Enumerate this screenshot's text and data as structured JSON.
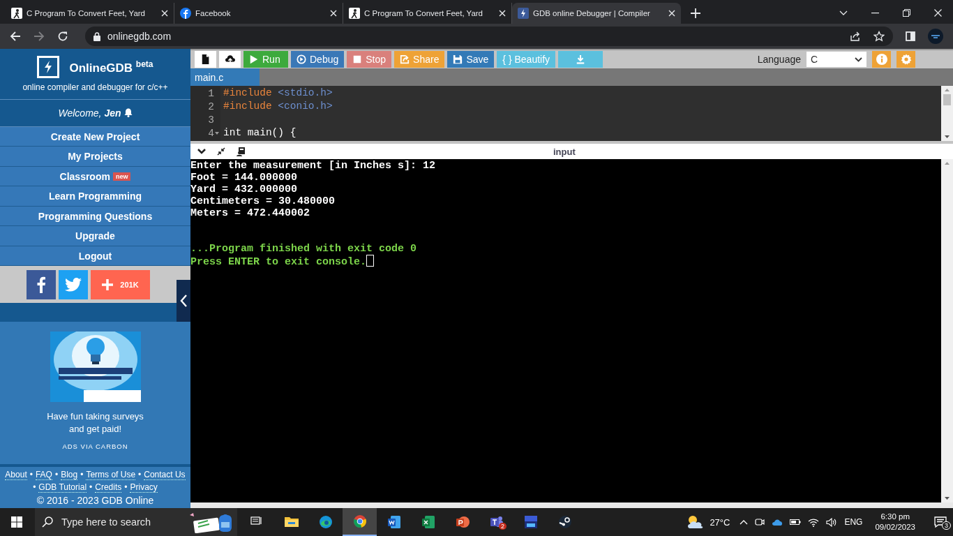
{
  "browser": {
    "tabs": [
      {
        "title": "C Program To Convert Feet, Yard",
        "kind": "figure",
        "selected": false
      },
      {
        "title": "Facebook",
        "kind": "facebook",
        "selected": false
      },
      {
        "title": "C Program To Convert Feet, Yard",
        "kind": "figure",
        "selected": false
      },
      {
        "title": "GDB online Debugger | Compiler",
        "kind": "bolt",
        "selected": true
      }
    ],
    "address": "onlinegdb.com"
  },
  "sidebar": {
    "brand": "OnlineGDB $^{beta}$",
    "tagline": "online compiler and debugger for c/c++",
    "welcome": "Welcome, **Jen**",
    "menu": [
      {
        "label": "Create New Project"
      },
      {
        "label": "My Projects"
      },
      {
        "label": "Classroom",
        "badge": "new"
      },
      {
        "label": "Learn Programming"
      },
      {
        "label": "Programming Questions"
      },
      {
        "label": "Upgrade"
      },
      {
        "label": "Logout"
      }
    ],
    "share_count": "201K",
    "ad": {
      "kind": "picture",
      "text": "Have fun taking surveys and get paid!",
      "via": "ADS VIA CARBON"
    },
    "separator": "•",
    "footer_rows": [
      {
        "lead_separator": false,
        "links": [
          "About",
          "FAQ",
          "Blog",
          "Terms of Use",
          "Contact Us"
        ]
      },
      {
        "lead_separator": true,
        "links": [
          "GDB Tutorial",
          "Credits",
          "Privacy"
        ]
      }
    ],
    "copyright": "© 2016 - 2023 GDB Online"
  },
  "toolbar": {
    "buttons": [
      {
        "kind": "new_file"
      },
      {
        "kind": "upload"
      },
      {
        "kind": "run",
        "label": "Run"
      },
      {
        "kind": "debug",
        "label": "Debug"
      },
      {
        "kind": "stop",
        "label": "Stop"
      },
      {
        "kind": "share",
        "label": "Share"
      },
      {
        "kind": "save",
        "label": "Save"
      },
      {
        "kind": "beautify",
        "label": "{ } Beautify"
      },
      {
        "kind": "download"
      }
    ],
    "language_label": "Language",
    "language": "C"
  },
  "editor": {
    "file_tab": "main.c",
    "lines": [
      {
        "number": "1",
        "tokens": [
          {
            "kind": "directive",
            "text": "#include"
          },
          {
            "kind": "header",
            "text": "<stdio.h>"
          }
        ]
      },
      {
        "number": "2",
        "tokens": [
          {
            "kind": "directive",
            "text": "#include"
          },
          {
            "kind": "header",
            "text": "<conio.h>"
          }
        ]
      },
      {
        "number": "3"
      },
      {
        "number": "4",
        "foldable": true,
        "tokens": [
          {
            "kind": "plain",
            "text": "int main() {"
          }
        ]
      }
    ]
  },
  "console": {
    "title": "input",
    "cursor": true,
    "lines": [
      {
        "kind": "output",
        "text": "Enter the measurement [in Inches s]: 12"
      },
      {
        "kind": "output",
        "text": "Foot = 144.000000"
      },
      {
        "kind": "output",
        "text": "Yard = 432.000000"
      },
      {
        "kind": "output",
        "text": "Centimeters = 30.480000"
      },
      {
        "kind": "output",
        "text": "Meters = 472.440002"
      },
      {
        "kind": "status",
        "text": "...Program finished with exit code 0"
      },
      {
        "kind": "status",
        "text": "Press ENTER to exit console."
      }
    ]
  },
  "taskbar": {
    "search_placeholder": "Type here to search",
    "apps": [
      {
        "kind": "taskview",
        "selected": false
      },
      {
        "kind": "explorer",
        "selected": false
      },
      {
        "kind": "edge",
        "selected": false
      },
      {
        "kind": "chrome",
        "selected": true
      },
      {
        "kind": "word",
        "selected": false
      },
      {
        "kind": "excel",
        "selected": false
      },
      {
        "kind": "powerpoint",
        "selected": false
      },
      {
        "kind": "teams",
        "selected": false,
        "badge": "2"
      },
      {
        "kind": "devcpp",
        "selected": false
      },
      {
        "kind": "steam",
        "selected": false
      }
    ],
    "weather": "27°C",
    "input_language": "ENG",
    "time": "6:30 pm",
    "date": "09/02/2023",
    "notifications": "3"
  }
}
